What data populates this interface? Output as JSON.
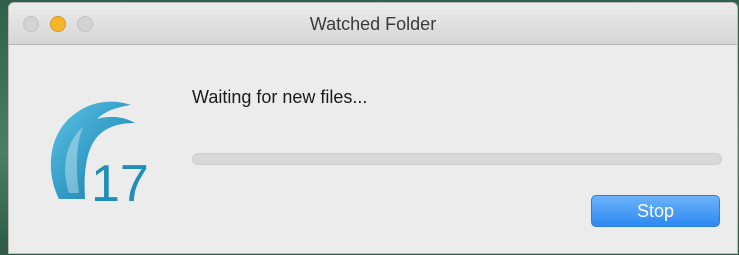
{
  "window": {
    "title": "Watched Folder"
  },
  "logo": {
    "icon": "app-logo-17-icon",
    "text": "17",
    "color": "#1d8fb8"
  },
  "status": {
    "message": "Waiting for new files..."
  },
  "progress": {
    "value": 0
  },
  "buttons": {
    "stop_label": "Stop"
  },
  "colors": {
    "accent": "#2d88f2",
    "minimize": "#f5b62d"
  }
}
